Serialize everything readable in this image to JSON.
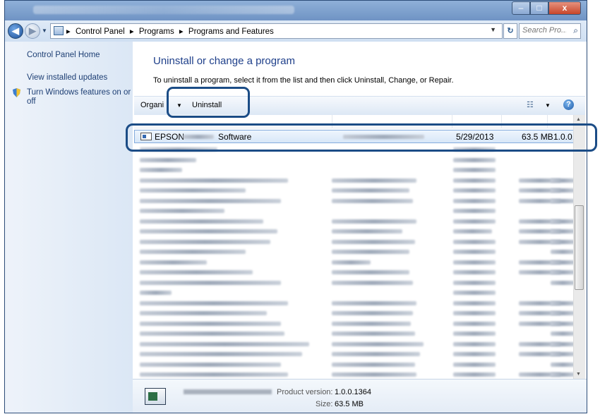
{
  "window": {
    "controls": {
      "minimize": "–",
      "maximize": "□",
      "close": "x"
    }
  },
  "nav": {
    "back_glyph": "◀",
    "forward_glyph": "▶"
  },
  "address": {
    "crumbs": [
      "▸",
      "Control Panel",
      "▸",
      "Programs",
      "▸",
      "Programs and Features"
    ],
    "refresh_glyph": "↻"
  },
  "search": {
    "placeholder": "Search Pro..."
  },
  "sidebar": {
    "home": "Control Panel Home",
    "updates": "View installed updates",
    "features_line1": "Turn Windows features on or",
    "features_line2": "off"
  },
  "main": {
    "title": "Uninstall or change a program",
    "subtitle": "To uninstall a program, select it from the list and then click Uninstall, Change, or Repair."
  },
  "toolbar": {
    "organize": "Organi",
    "uninstall": "Uninstall",
    "views_glyph": "☷",
    "help": "?"
  },
  "selected_row": {
    "name_prefix": "EPSON",
    "name_suffix": "Software",
    "installed_on": "5/29/2013",
    "size": "63.5 MB",
    "version": "1.0.0."
  },
  "details": {
    "product_version_label": "Product version:",
    "product_version": "1.0.0.1364",
    "size_label": "Size:",
    "size": "63.5 MB"
  },
  "colors": {
    "accent": "#1e3f8a",
    "highlight_ring": "#1b4c86"
  }
}
